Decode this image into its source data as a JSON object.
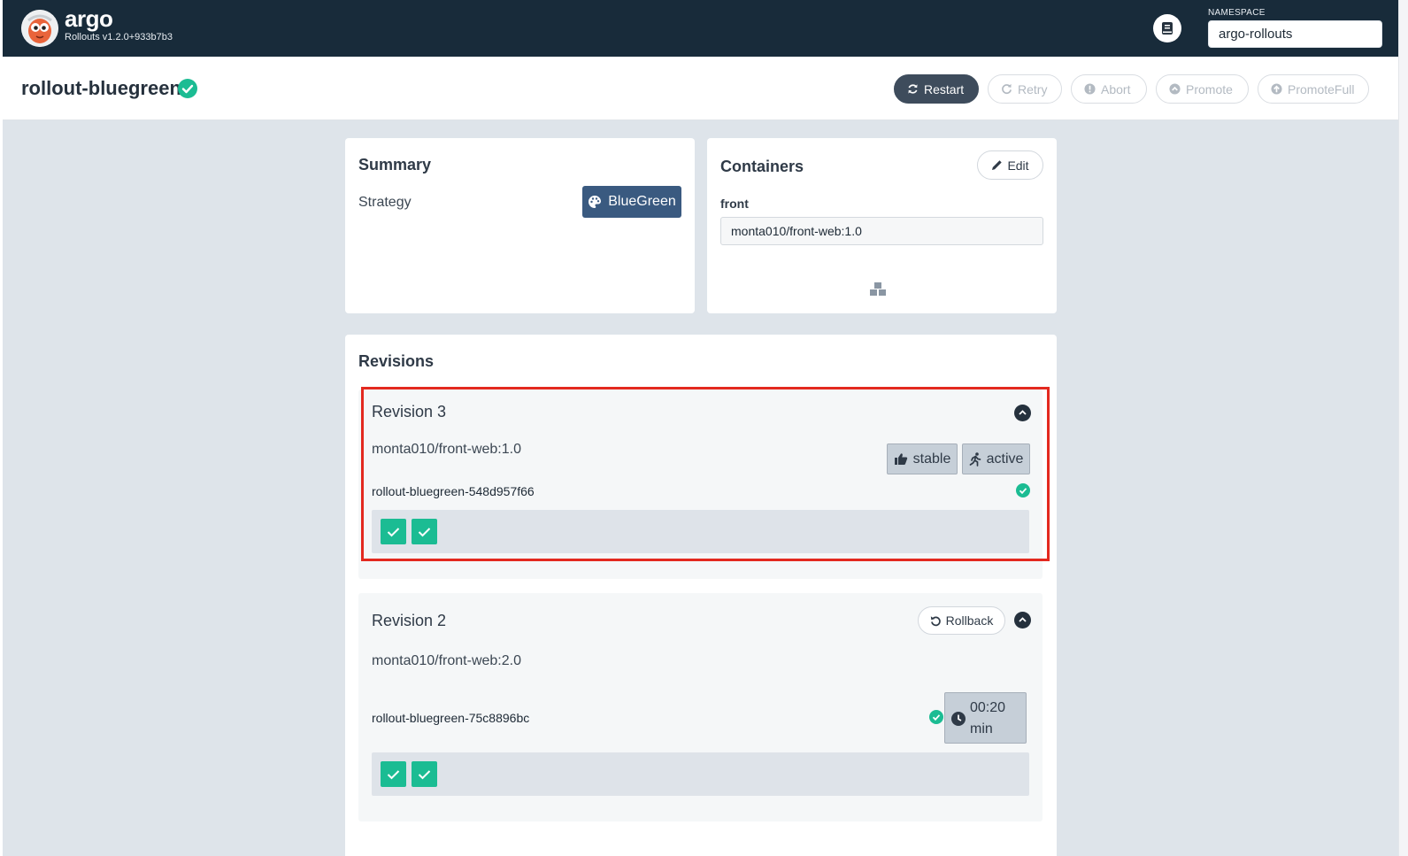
{
  "header": {
    "brand": "argo",
    "version": "Rollouts v1.2.0+933b7b3",
    "namespace_label": "NAMESPACE",
    "namespace_value": "argo-rollouts"
  },
  "rollout": {
    "name": "rollout-bluegreen",
    "actions": [
      "Restart",
      "Retry",
      "Abort",
      "Promote",
      "PromoteFull"
    ]
  },
  "summary": {
    "title": "Summary",
    "strategy_label": "Strategy",
    "strategy_value": "BlueGreen"
  },
  "containers": {
    "title": "Containers",
    "edit_label": "Edit",
    "items": [
      {
        "name": "front",
        "image": "monta010/front-web:1.0"
      }
    ]
  },
  "revisions": {
    "title": "Revisions",
    "items": [
      {
        "title": "Revision 3",
        "image": "monta010/front-web:1.0",
        "tags": [
          "stable",
          "active"
        ],
        "replicaset": "rollout-bluegreen-548d957f66",
        "pods": 2
      },
      {
        "title": "Revision 2",
        "rollback_label": "Rollback",
        "image": "monta010/front-web:2.0",
        "replicaset": "rollout-bluegreen-75c8896bc",
        "timer_value": "00:20",
        "timer_unit": "min",
        "pods": 2
      }
    ]
  },
  "colors": {
    "topbar": "#182b3a",
    "healthy": "#1bbc93",
    "strategy_badge": "#3a5a80",
    "highlight": "#e3291f"
  },
  "icons": {
    "logo": "argo-octopus-logo",
    "docs": "book-icon",
    "healthy": "check-circle-icon",
    "restart": "sync-icon",
    "retry": "redo-icon",
    "abort": "exclamation-circle-icon",
    "promote": "chevron-circle-up-icon",
    "promote_full": "arrow-circle-up-icon",
    "strategy": "palette-icon",
    "edit": "pencil-icon",
    "boxes": "cubes-icon",
    "collapse": "chevron-circle-up-icon",
    "stable": "thumbs-up-icon",
    "active": "running-icon",
    "rollback": "undo-icon",
    "timer": "clock-icon"
  }
}
